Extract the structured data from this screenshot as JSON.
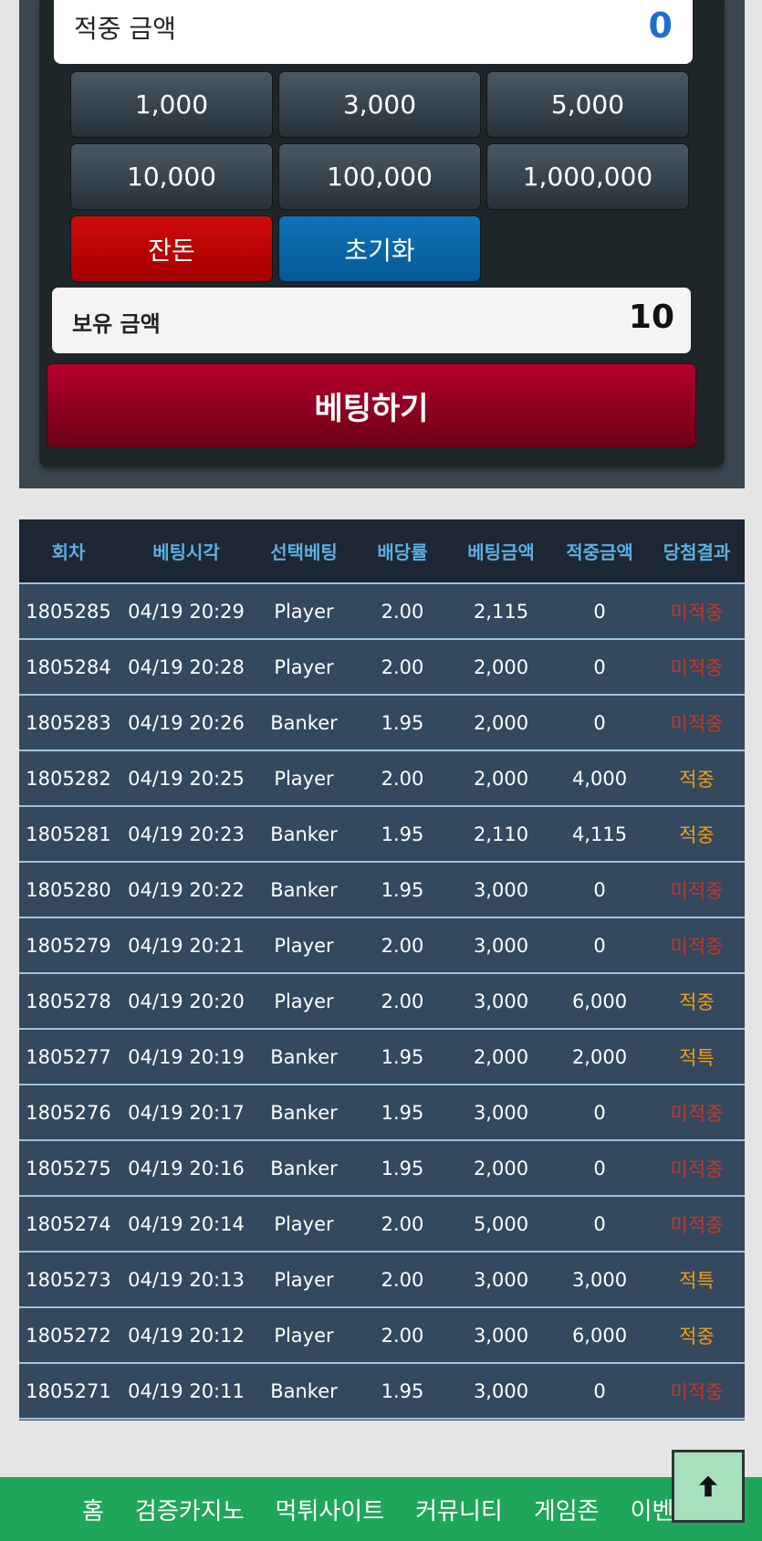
{
  "bet_panel": {
    "hit_amount_label": "적중 금액",
    "hit_amount_value": "0",
    "chips": [
      "1,000",
      "3,000",
      "5,000",
      "10,000",
      "100,000",
      "1,000,000"
    ],
    "balance_button": "잔돈",
    "reset_button": "초기화",
    "hold_amount_label": "보유 금액",
    "hold_amount_value": "10",
    "bet_button": "베팅하기"
  },
  "history": {
    "headers": [
      "회차",
      "베팅시각",
      "선택베팅",
      "배당률",
      "베팅금액",
      "적중금액",
      "당첨결과"
    ],
    "rows": [
      [
        "1805285",
        "04/19 20:29",
        "Player",
        "2.00",
        "2,115",
        "0",
        "미적중"
      ],
      [
        "1805284",
        "04/19 20:28",
        "Player",
        "2.00",
        "2,000",
        "0",
        "미적중"
      ],
      [
        "1805283",
        "04/19 20:26",
        "Banker",
        "1.95",
        "2,000",
        "0",
        "미적중"
      ],
      [
        "1805282",
        "04/19 20:25",
        "Player",
        "2.00",
        "2,000",
        "4,000",
        "적중"
      ],
      [
        "1805281",
        "04/19 20:23",
        "Banker",
        "1.95",
        "2,110",
        "4,115",
        "적중"
      ],
      [
        "1805280",
        "04/19 20:22",
        "Banker",
        "1.95",
        "3,000",
        "0",
        "미적중"
      ],
      [
        "1805279",
        "04/19 20:21",
        "Player",
        "2.00",
        "3,000",
        "0",
        "미적중"
      ],
      [
        "1805278",
        "04/19 20:20",
        "Player",
        "2.00",
        "3,000",
        "6,000",
        "적중"
      ],
      [
        "1805277",
        "04/19 20:19",
        "Banker",
        "1.95",
        "2,000",
        "2,000",
        "적특"
      ],
      [
        "1805276",
        "04/19 20:17",
        "Banker",
        "1.95",
        "3,000",
        "0",
        "미적중"
      ],
      [
        "1805275",
        "04/19 20:16",
        "Banker",
        "1.95",
        "2,000",
        "0",
        "미적중"
      ],
      [
        "1805274",
        "04/19 20:14",
        "Player",
        "2.00",
        "5,000",
        "0",
        "미적중"
      ],
      [
        "1805273",
        "04/19 20:13",
        "Player",
        "2.00",
        "3,000",
        "3,000",
        "적특"
      ],
      [
        "1805272",
        "04/19 20:12",
        "Player",
        "2.00",
        "3,000",
        "6,000",
        "적중"
      ],
      [
        "1805271",
        "04/19 20:11",
        "Banker",
        "1.95",
        "3,000",
        "0",
        "미적중"
      ]
    ]
  },
  "bottom_nav": [
    "홈",
    "검증카지노",
    "먹튀사이트",
    "커뮤니티",
    "게임존",
    "이벤트"
  ],
  "colors": {
    "miss": "#c0392b",
    "hit": "#f39c12",
    "header_text": "#5dade2",
    "nav_bg": "#20a65a"
  },
  "icons": {
    "scroll_top": "arrow-up-icon"
  }
}
